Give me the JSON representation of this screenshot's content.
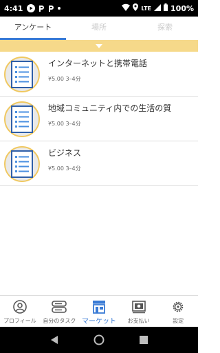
{
  "status_bar": {
    "time": "4:41",
    "network": "LTE",
    "battery": "100%",
    "icons": [
      "play-icon",
      "parking-icon",
      "parking-icon",
      "dot-icon",
      "wifi-icon",
      "location-icon",
      "signal-icon",
      "battery-icon"
    ]
  },
  "tabs": [
    {
      "label": "アンケート",
      "active": true
    },
    {
      "label": "場所",
      "active": false
    },
    {
      "label": "探索",
      "active": false
    }
  ],
  "filter": {
    "icon": "triangle-down-icon",
    "color": "#f6d98a"
  },
  "surveys": [
    {
      "title": "インターネットと携帯電話",
      "reward": "¥5.00",
      "duration": "3–4分"
    },
    {
      "title": "地域コミュニティ内での生活の質",
      "reward": "¥5.00",
      "duration": "3–4分"
    },
    {
      "title": "ビジネス",
      "reward": "¥5.00",
      "duration": "3–4分"
    }
  ],
  "bottom_nav": [
    {
      "label": "プロフィール",
      "icon": "user-icon",
      "active": false
    },
    {
      "label": "自分のタスク",
      "icon": "tasks-icon",
      "active": false
    },
    {
      "label": "マーケット",
      "icon": "store-icon",
      "active": true
    },
    {
      "label": "お支払い",
      "icon": "payment-icon",
      "active": false
    },
    {
      "label": "設定",
      "icon": "gear-icon",
      "active": false
    }
  ],
  "colors": {
    "accent": "#3a7bd5",
    "filter_bar": "#f6d98a",
    "thumb_border": "#f0c860"
  }
}
